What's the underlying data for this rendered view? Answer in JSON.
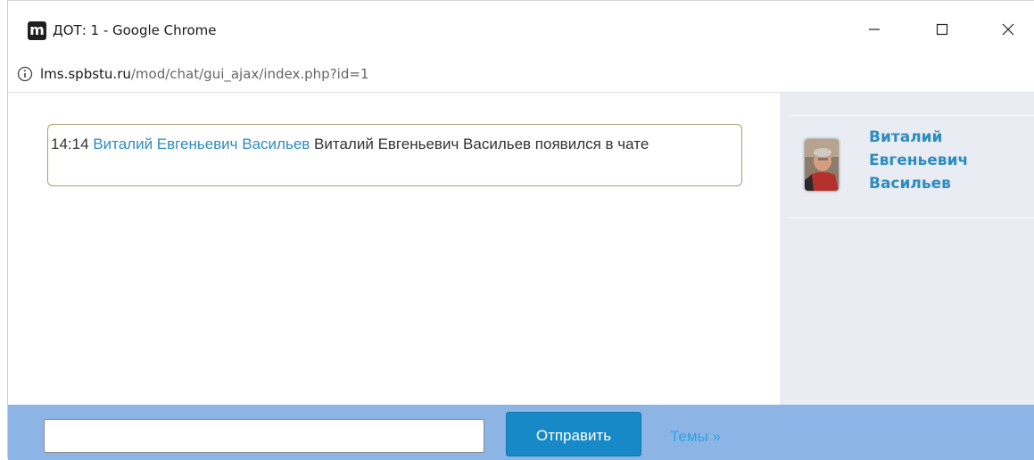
{
  "window": {
    "app_icon_letter": "m",
    "title": "ДОТ: 1 - Google Chrome"
  },
  "addressbar": {
    "domain": "lms.spbstu.ru",
    "path": "/mod/chat/gui_ajax/index.php?id=1"
  },
  "chat": {
    "messages": [
      {
        "time": "14:14",
        "user": "Виталий Евгеньевич Васильев",
        "text": "Виталий Евгеньевич Васильев появился в чате"
      }
    ]
  },
  "userlist": {
    "users": [
      {
        "name": "Виталий Евгеньевич Васильев"
      }
    ]
  },
  "inputbar": {
    "input_value": "",
    "send_label": "Отправить",
    "themes_label": "Темы »"
  },
  "colors": {
    "link": "#2d8cc0",
    "inputbar_bg": "#8cb4e5",
    "send_button_bg": "#1789c6",
    "userlist_bg": "#e9ecf3"
  }
}
